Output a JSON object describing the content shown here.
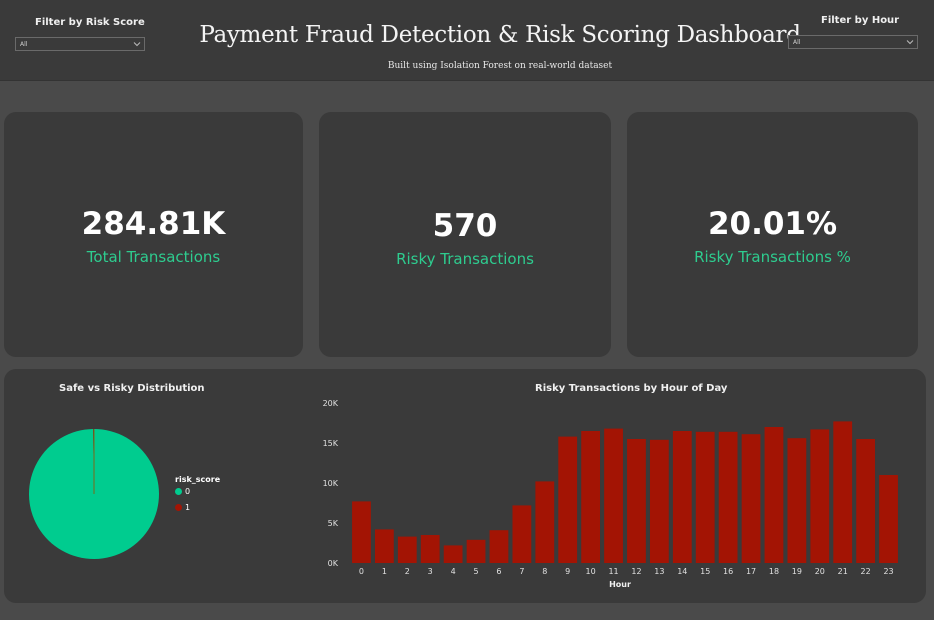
{
  "header": {
    "title": "Payment Fraud Detection & Risk Scoring Dashboard",
    "subtitle": "Built using Isolation Forest on real-world dataset",
    "filter_risk": {
      "label": "Filter by Risk Score",
      "value": "All"
    },
    "filter_hour": {
      "label": "Filter by Hour",
      "value": "All"
    }
  },
  "kpis": [
    {
      "value": "284.81K",
      "label": "Total Transactions"
    },
    {
      "value": "570",
      "label": "Risky Transactions"
    },
    {
      "value": "20.01%",
      "label": "Risky Transactions %"
    }
  ],
  "colors": {
    "safe": "#00cc8f",
    "risky": "#a31404",
    "card": "#3a3a3a",
    "kpi_label": "#2ecc8f"
  },
  "pie_panel": {
    "title": "Safe vs Risky Distribution",
    "legend_title": "risk_score",
    "legend_items": [
      "0",
      "1"
    ]
  },
  "bar_panel": {
    "title": "Risky Transactions by Hour of Day"
  },
  "chart_data": [
    {
      "type": "pie",
      "title": "Safe vs Risky Distribution",
      "labels": [
        "0",
        "1"
      ],
      "values": [
        284237,
        570
      ],
      "legend_title": "risk_score",
      "legend_placement": "right"
    },
    {
      "type": "bar",
      "title": "Risky Transactions by Hour of Day",
      "xlabel": "Hour",
      "ylabel": "",
      "categories": [
        "0",
        "1",
        "2",
        "3",
        "4",
        "5",
        "6",
        "7",
        "8",
        "9",
        "10",
        "11",
        "12",
        "13",
        "14",
        "15",
        "16",
        "17",
        "18",
        "19",
        "20",
        "21",
        "22",
        "23"
      ],
      "values": [
        7700,
        4200,
        3300,
        3500,
        2200,
        2900,
        4100,
        7200,
        10200,
        15800,
        16500,
        16800,
        15500,
        15400,
        16500,
        16400,
        16400,
        16100,
        17000,
        15600,
        16700,
        17700,
        15500,
        11000
      ],
      "ylim": [
        0,
        20000
      ],
      "yticks": [
        "0K",
        "5K",
        "10K",
        "15K",
        "20K"
      ],
      "grid": false
    }
  ]
}
